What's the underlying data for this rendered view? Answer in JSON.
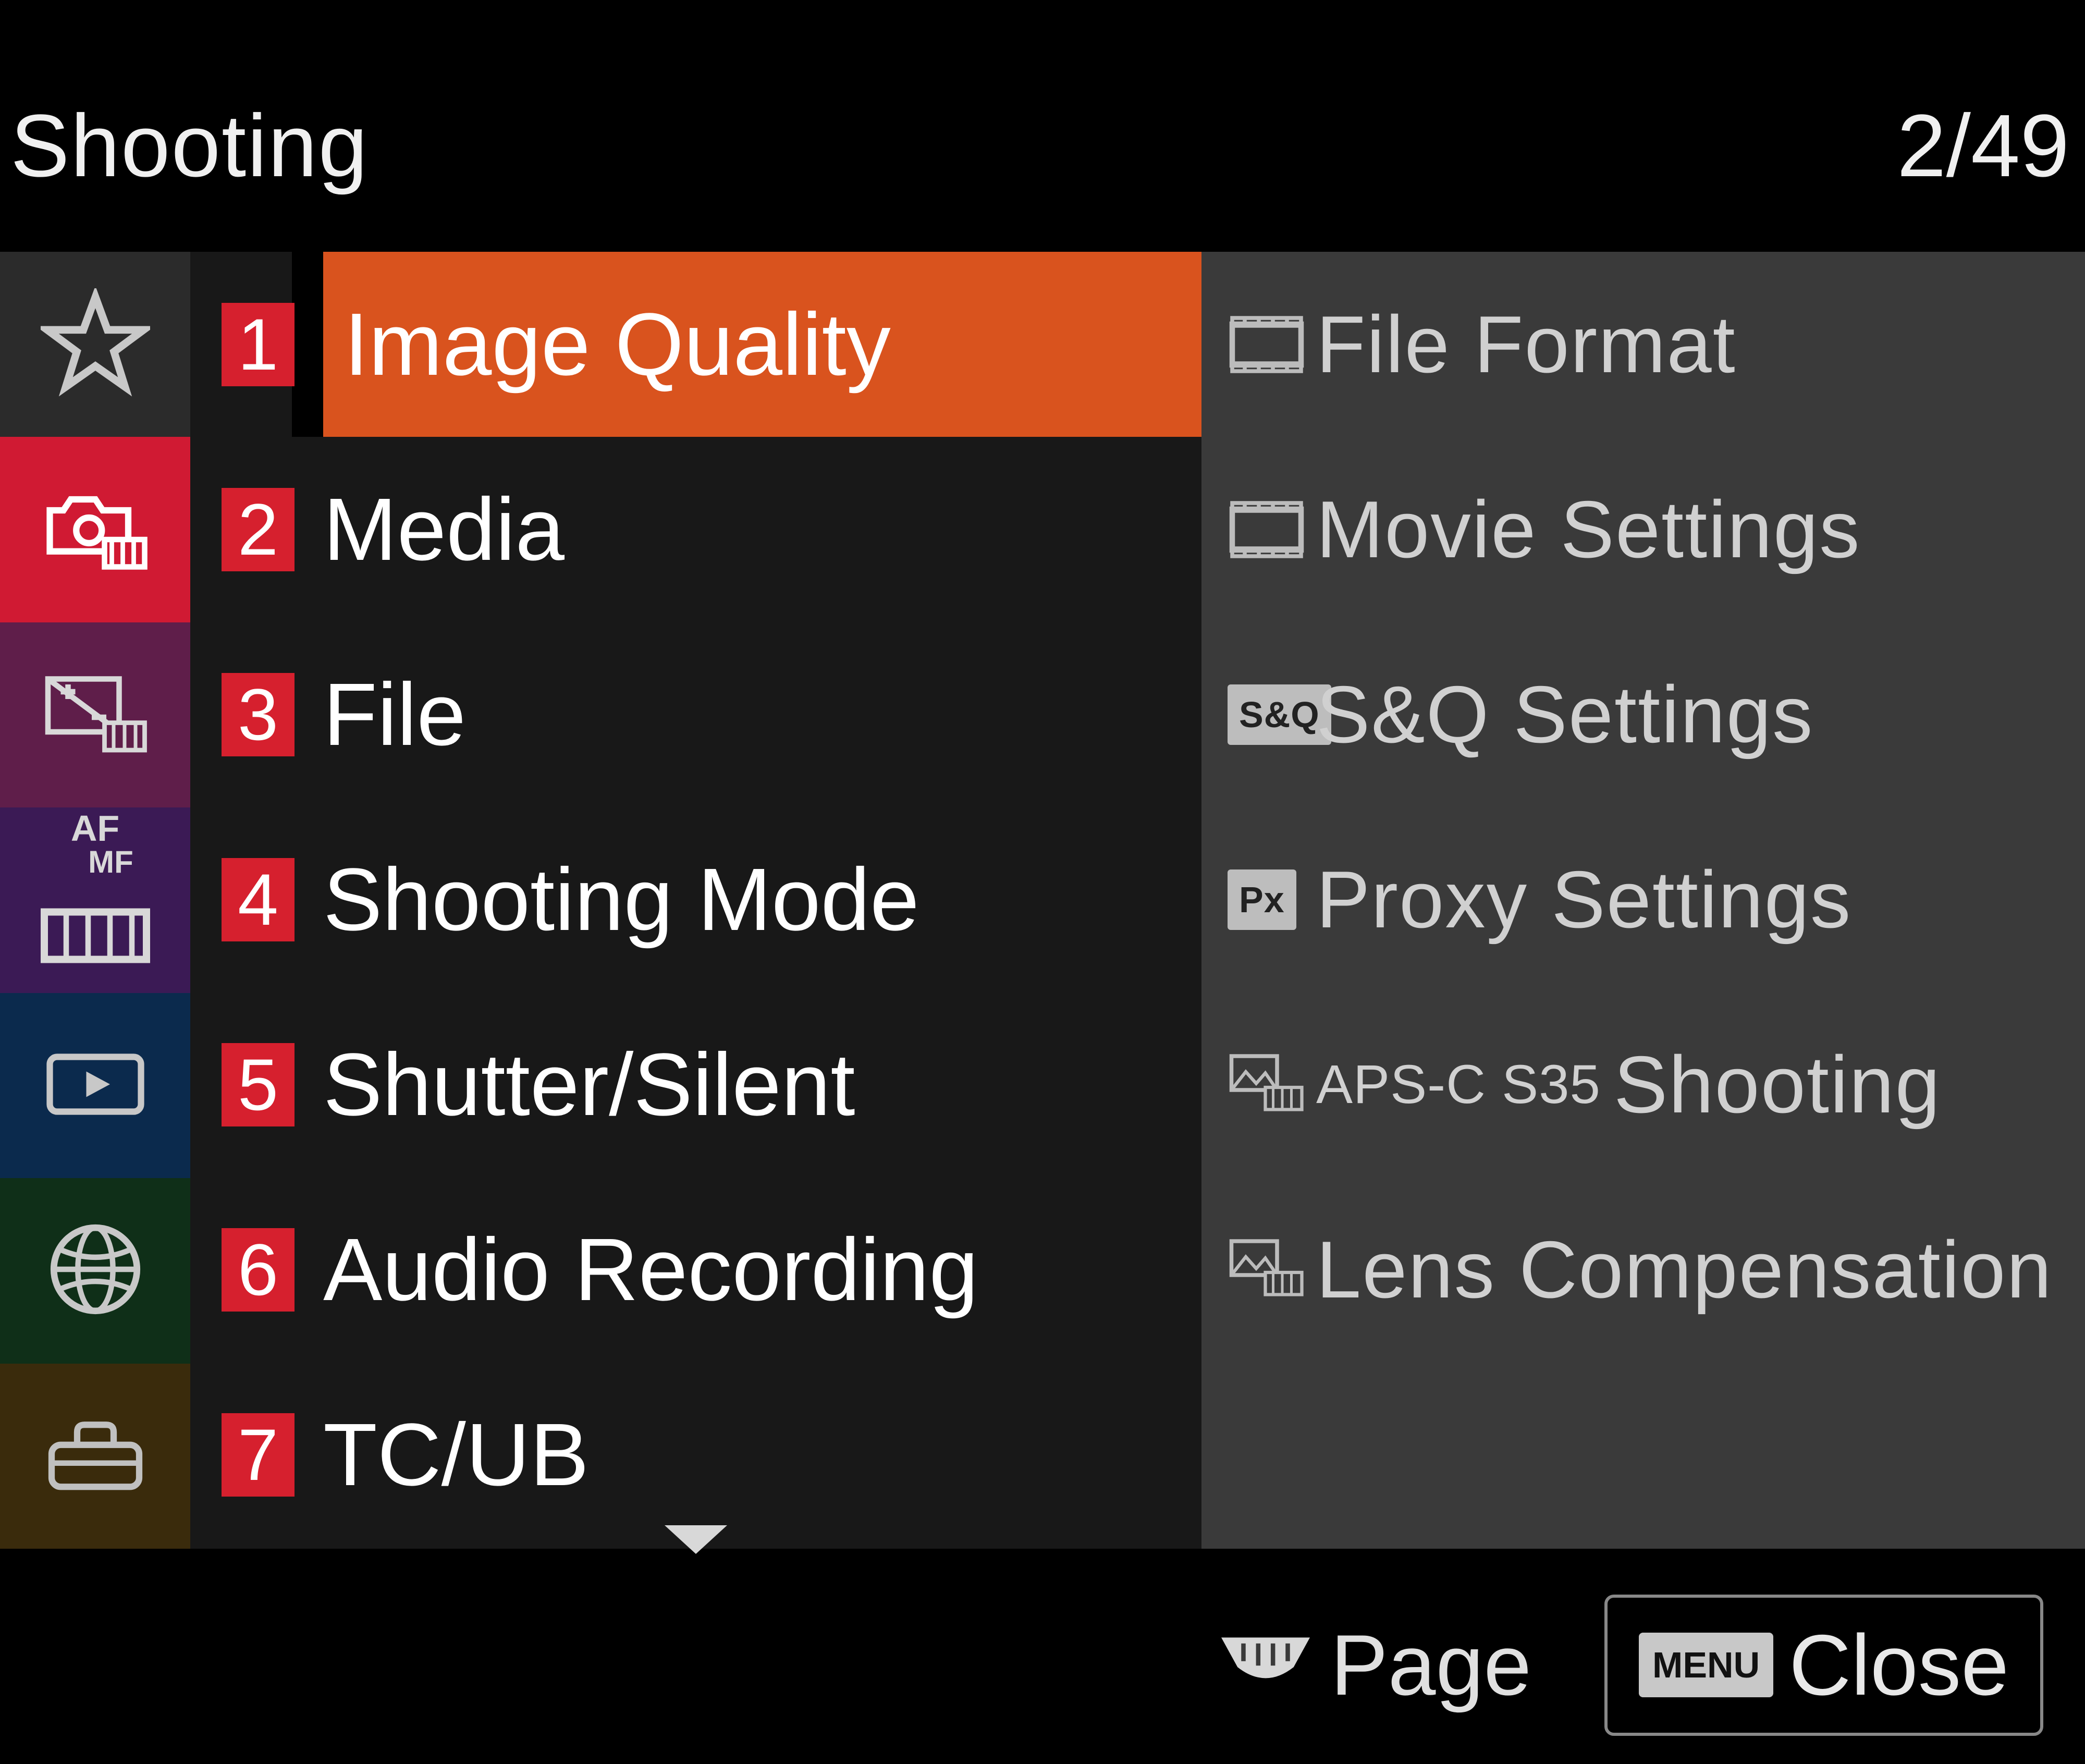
{
  "header": {
    "title": "Shooting",
    "page_indicator": "2/49"
  },
  "colors": {
    "accent_red": "#d6202e",
    "selected_orange": "#d9531e",
    "sidebar_tabs": [
      "#2b2b2b",
      "#d01a33",
      "#5f1e4a",
      "#3b1a55",
      "#0b2a4d",
      "#0f2f18",
      "#3a2b0c"
    ]
  },
  "sidebar": {
    "selected_index": 1,
    "tabs": [
      {
        "name": "favorites-tab",
        "icon": "star-icon"
      },
      {
        "name": "shooting-tab",
        "icon": "camera-film-icon"
      },
      {
        "name": "exposure-tab",
        "icon": "exposure-film-icon"
      },
      {
        "name": "focus-tab",
        "icon": "af-mf-film-icon",
        "text_top": "AF",
        "text_bottom": "MF"
      },
      {
        "name": "playback-tab",
        "icon": "playback-icon"
      },
      {
        "name": "network-tab",
        "icon": "globe-icon"
      },
      {
        "name": "setup-tab",
        "icon": "toolbox-icon"
      }
    ]
  },
  "categories": {
    "selected_index": 0,
    "items": [
      {
        "num": "1",
        "label": "Image Quality"
      },
      {
        "num": "2",
        "label": "Media"
      },
      {
        "num": "3",
        "label": "File"
      },
      {
        "num": "4",
        "label": "Shooting Mode"
      },
      {
        "num": "5",
        "label": "Shutter/Silent"
      },
      {
        "num": "6",
        "label": "Audio Recording"
      },
      {
        "num": "7",
        "label": "TC/UB"
      }
    ]
  },
  "options": {
    "items": [
      {
        "icon": "film-icon",
        "label": "File Format"
      },
      {
        "icon": "film-icon",
        "label": "Movie Settings"
      },
      {
        "icon": "badge",
        "badge_text": "S&Q",
        "label": "S&Q Settings"
      },
      {
        "icon": "badge",
        "badge_text": "Px",
        "label": "Proxy Settings"
      },
      {
        "icon": "capture-film-icon",
        "prefix_small": "APS-C S35",
        "label": "Shooting"
      },
      {
        "icon": "capture-film-icon",
        "label": "Lens Compensation"
      }
    ]
  },
  "footer": {
    "page_label": "Page",
    "close_badge": "MENU",
    "close_label": "Close"
  }
}
